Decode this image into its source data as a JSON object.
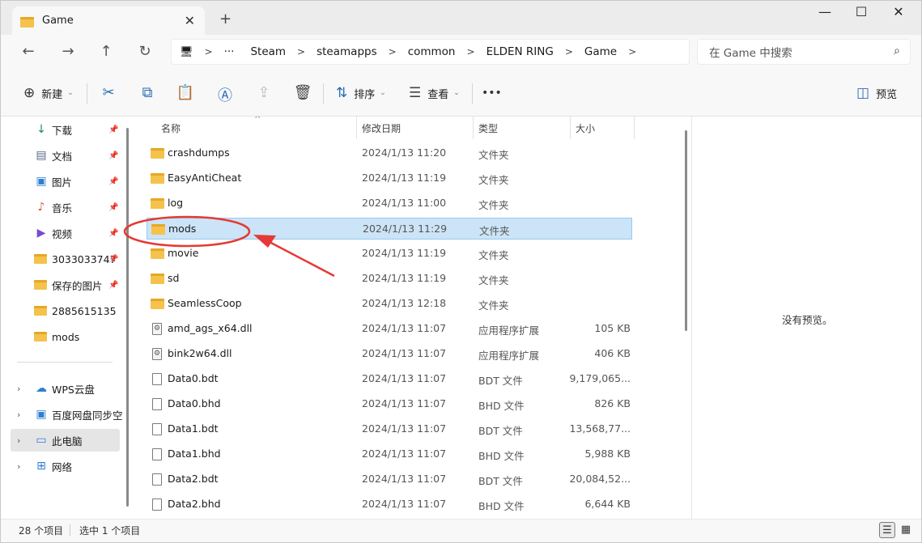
{
  "window": {
    "tab_title": "Game",
    "close_glyph": "✕",
    "newtab_glyph": "+",
    "minimize_glyph": "—",
    "maximize_glyph": "☐",
    "winclose_glyph": "✕"
  },
  "nav": {
    "back_glyph": "←",
    "forward_glyph": "→",
    "up_glyph": "↑",
    "refresh_glyph": "↻",
    "computer_glyph": "🖥",
    "more_glyph": "···",
    "sep": ">",
    "breadcrumbs": [
      "Steam",
      "steamapps",
      "common",
      "ELDEN RING",
      "Game"
    ],
    "search_placeholder": "在 Game 中搜索",
    "search_glyph": "⌕"
  },
  "commands": {
    "new_label": "新建",
    "new_glyph": "⊕",
    "caret": "⌄",
    "cut_glyph": "✂",
    "copy_glyph": "⧉",
    "paste_glyph": "📋",
    "rename_glyph": "Ⓐ",
    "share_glyph": "⇪",
    "delete_glyph": "🗑",
    "sort_label": "排序",
    "sort_glyph": "⇅",
    "view_label": "查看",
    "view_glyph": "☰",
    "more_glyph": "•••",
    "preview_label": "预览",
    "preview_glyph": "◫"
  },
  "sidebar": {
    "items": [
      {
        "label": "下载",
        "icon": "↓",
        "pinned": true,
        "color": "#1e8a5a"
      },
      {
        "label": "文档",
        "icon": "▤",
        "pinned": true,
        "color": "#5a6a8a"
      },
      {
        "label": "图片",
        "icon": "▣",
        "pinned": true,
        "color": "#2f7fd0"
      },
      {
        "label": "音乐",
        "icon": "♪",
        "pinned": true,
        "color": "#d05a3a"
      },
      {
        "label": "视频",
        "icon": "▶",
        "pinned": true,
        "color": "#7a4ad0"
      },
      {
        "label": "3033033747",
        "icon": "folder",
        "pinned": true
      },
      {
        "label": "保存的图片",
        "icon": "folder",
        "pinned": true
      },
      {
        "label": "2885615135",
        "icon": "folder",
        "pinned": false
      },
      {
        "label": "mods",
        "icon": "folder",
        "pinned": false
      }
    ],
    "pin_glyph": "📌",
    "expand_glyph": "›",
    "locations": [
      {
        "label": "WPS云盘",
        "icon": "☁",
        "color": "#2f7fd0"
      },
      {
        "label": "百度网盘同步空",
        "icon": "▣",
        "color": "#2f7fd0"
      },
      {
        "label": "此电脑",
        "icon": "▭",
        "color": "#2f7fd0",
        "selected": true
      },
      {
        "label": "网络",
        "icon": "⊞",
        "color": "#2f7fd0"
      }
    ]
  },
  "columns": {
    "name": "名称",
    "modified": "修改日期",
    "type": "类型",
    "size": "大小",
    "sort_glyph": "^"
  },
  "files": [
    {
      "name": "crashdumps",
      "date": "2024/1/13 11:20",
      "type": "文件夹",
      "size": "",
      "kind": "folder"
    },
    {
      "name": "EasyAntiCheat",
      "date": "2024/1/13 11:19",
      "type": "文件夹",
      "size": "",
      "kind": "folder"
    },
    {
      "name": "log",
      "date": "2024/1/13 11:00",
      "type": "文件夹",
      "size": "",
      "kind": "folder"
    },
    {
      "name": "mods",
      "date": "2024/1/13 11:29",
      "type": "文件夹",
      "size": "",
      "kind": "folder",
      "selected": true
    },
    {
      "name": "movie",
      "date": "2024/1/13 11:19",
      "type": "文件夹",
      "size": "",
      "kind": "folder"
    },
    {
      "name": "sd",
      "date": "2024/1/13 11:19",
      "type": "文件夹",
      "size": "",
      "kind": "folder"
    },
    {
      "name": "SeamlessCoop",
      "date": "2024/1/13 12:18",
      "type": "文件夹",
      "size": "",
      "kind": "folder"
    },
    {
      "name": "amd_ags_x64.dll",
      "date": "2024/1/13 11:07",
      "type": "应用程序扩展",
      "size": "105 KB",
      "kind": "dll"
    },
    {
      "name": "bink2w64.dll",
      "date": "2024/1/13 11:07",
      "type": "应用程序扩展",
      "size": "406 KB",
      "kind": "dll"
    },
    {
      "name": "Data0.bdt",
      "date": "2024/1/13 11:07",
      "type": "BDT 文件",
      "size": "9,179,065...",
      "kind": "file"
    },
    {
      "name": "Data0.bhd",
      "date": "2024/1/13 11:07",
      "type": "BHD 文件",
      "size": "826 KB",
      "kind": "file"
    },
    {
      "name": "Data1.bdt",
      "date": "2024/1/13 11:07",
      "type": "BDT 文件",
      "size": "13,568,77...",
      "kind": "file"
    },
    {
      "name": "Data1.bhd",
      "date": "2024/1/13 11:07",
      "type": "BHD 文件",
      "size": "5,988 KB",
      "kind": "file"
    },
    {
      "name": "Data2.bdt",
      "date": "2024/1/13 11:07",
      "type": "BDT 文件",
      "size": "20,084,52...",
      "kind": "file"
    },
    {
      "name": "Data2.bhd",
      "date": "2024/1/13 11:07",
      "type": "BHD 文件",
      "size": "6,644 KB",
      "kind": "file"
    }
  ],
  "preview": {
    "empty_text": "没有预览。"
  },
  "status": {
    "item_count": "28 个项目",
    "selected": "选中 1 个项目",
    "details_glyph": "☰",
    "tiles_glyph": "▦"
  },
  "colors": {
    "accent": "#2b6cb3",
    "selection": "#cce4f7",
    "annotation_red": "#e53935",
    "folder": "#f4c24d"
  }
}
